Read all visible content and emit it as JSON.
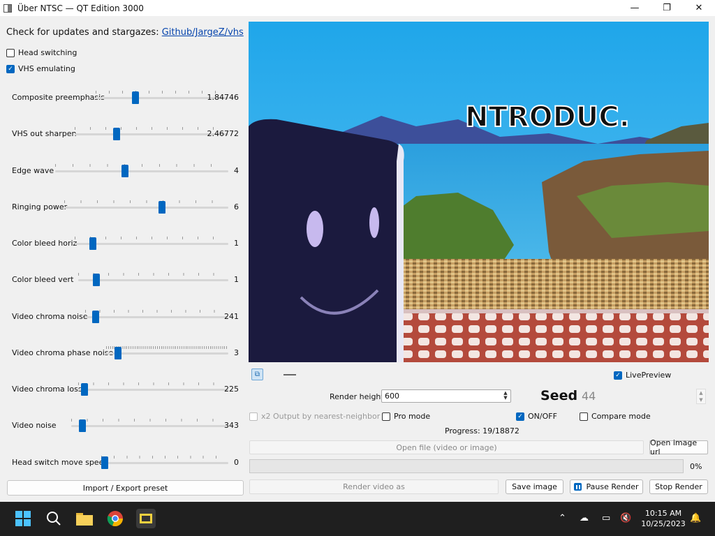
{
  "window": {
    "title": "Über NTSC — QT Edition 3000",
    "minimize": "—",
    "maximize": "❐",
    "close": "✕"
  },
  "left": {
    "updates_text": "Check for updates and stargazes: ",
    "updates_link": "Github/JargeZ/vhs",
    "head_switching": "Head switching",
    "vhs_emulating": "VHS emulating",
    "sliders": [
      {
        "label": "Composite preemphasis",
        "value": "1.84746",
        "fraction": 0.29
      },
      {
        "label": "VHS out sharpen",
        "value": "2.46772",
        "fraction": 0.26
      },
      {
        "label": "Edge wave",
        "value": "4",
        "fraction": 0.4
      },
      {
        "label": "Ringing power",
        "value": "6",
        "fraction": 0.6
      },
      {
        "label": "Color bleed horiz",
        "value": "1",
        "fraction": 0.1
      },
      {
        "label": "Color bleed vert",
        "value": "1",
        "fraction": 0.1
      },
      {
        "label": "Video chroma noise",
        "value": "241",
        "fraction": 0.05
      },
      {
        "label": "Video chroma phase noise",
        "value": "3",
        "fraction": 0.07
      },
      {
        "label": "Video chroma loss",
        "value": "225",
        "fraction": 0.02
      },
      {
        "label": "Video noise",
        "value": "343",
        "fraction": 0.05
      },
      {
        "label": "Head switch move speed",
        "value": "0",
        "fraction": 0.0
      }
    ],
    "import_export": "Import / Export preset"
  },
  "preview": {
    "overlay_text": "NTRODUC."
  },
  "controls": {
    "live_preview": "LivePreview",
    "render_height_label": "Render height",
    "render_height_value": "600",
    "seed_label": "Seed",
    "seed_value": "44",
    "x2_output": "x2 Output by nearest-neighbor",
    "pro_mode": "Pro mode",
    "on_off": "ON/OFF",
    "compare_mode": "Compare mode",
    "progress": "Progress: 19/18872",
    "open_file": "Open file (video or image)",
    "open_image_url": "Open image url",
    "progress_percent": "0%",
    "progress_fraction": 0.0,
    "render_video_as": "Render video as",
    "save_image": "Save image",
    "pause_render": "Pause Render",
    "stop_render": "Stop Render"
  },
  "taskbar": {
    "time": "10:15 AM",
    "date": "10/25/2023",
    "accent": "#0067c0"
  }
}
